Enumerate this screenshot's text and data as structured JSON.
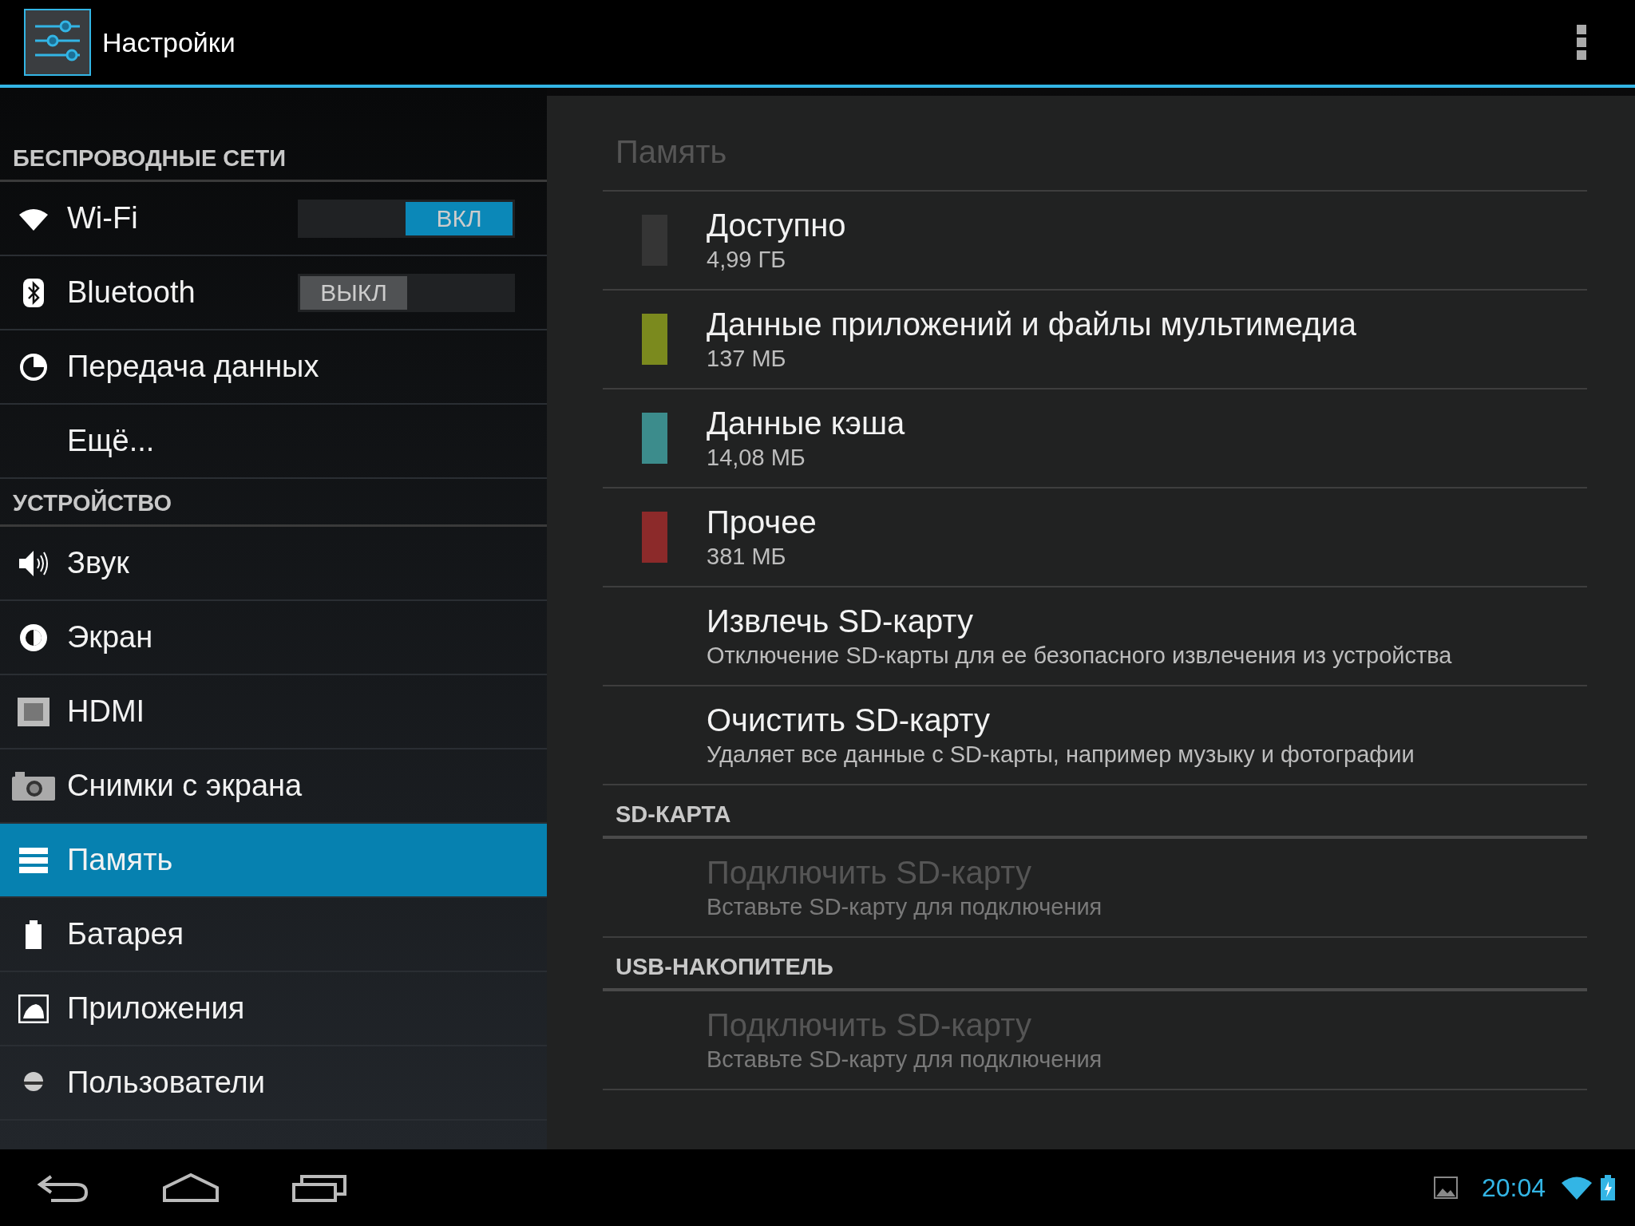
{
  "action_bar": {
    "title": "Настройки"
  },
  "sidebar": {
    "sections": [
      {
        "header": "БЕСПРОВОДНЫЕ СЕТИ",
        "items": [
          {
            "label": "Wi-Fi",
            "kind": "wifi",
            "selected": false,
            "switch": {
              "on": true,
              "label": "ВКЛ"
            }
          },
          {
            "label": "Bluetooth",
            "kind": "bluetooth",
            "selected": false,
            "switch": {
              "on": false,
              "label": "ВЫКЛ"
            }
          },
          {
            "label": "Передача данных",
            "kind": "data",
            "selected": false
          },
          {
            "label": "Ещё...",
            "kind": "plain",
            "selected": false
          }
        ]
      },
      {
        "header": "УСТРОЙСТВО",
        "items": [
          {
            "label": "Звук",
            "kind": "sound",
            "selected": false
          },
          {
            "label": "Экран",
            "kind": "display",
            "selected": false
          },
          {
            "label": "HDMI",
            "kind": "hdmi",
            "selected": false
          },
          {
            "label": "Снимки с экрана",
            "kind": "camera",
            "selected": false
          },
          {
            "label": "Память",
            "kind": "storage",
            "selected": true
          },
          {
            "label": "Батарея",
            "kind": "battery",
            "selected": false
          },
          {
            "label": "Приложения",
            "kind": "apps",
            "selected": false
          },
          {
            "label": "Пользователи",
            "kind": "user",
            "selected": false
          }
        ]
      }
    ]
  },
  "content": {
    "title": "Память",
    "items": [
      {
        "kind": "usage",
        "label": "Доступно",
        "value": "4,99 ГБ",
        "color": "#353535"
      },
      {
        "kind": "usage",
        "label": "Данные приложений и файлы мультимедиа",
        "value": "137 МБ",
        "color": "#7b8a1e"
      },
      {
        "kind": "usage",
        "label": "Данные кэша",
        "value": "14,08 МБ",
        "color": "#3c8c8c"
      },
      {
        "kind": "usage",
        "label": "Прочее",
        "value": "381 МБ",
        "color": "#8c2a2a"
      },
      {
        "kind": "action",
        "label": "Извлечь SD-карту",
        "summary": "Отключение SD-карты для ее безопасного извлечения из устройства",
        "disabled": false
      },
      {
        "kind": "action",
        "label": "Очистить SD-карту",
        "summary": "Удаляет все данные с SD-карты, например музыку и фотографии",
        "disabled": false
      },
      {
        "kind": "header",
        "label": "SD-КАРТА"
      },
      {
        "kind": "action",
        "label": "Подключить SD-карту",
        "summary": "Вставьте SD-карту для подключения",
        "disabled": true
      },
      {
        "kind": "header",
        "label": "USB-НАКОПИТЕЛЬ"
      },
      {
        "kind": "action",
        "label": "Подключить SD-карту",
        "summary": "Вставьте SD-карту для подключения",
        "disabled": true
      }
    ]
  },
  "status_bar": {
    "time": "20:04"
  }
}
